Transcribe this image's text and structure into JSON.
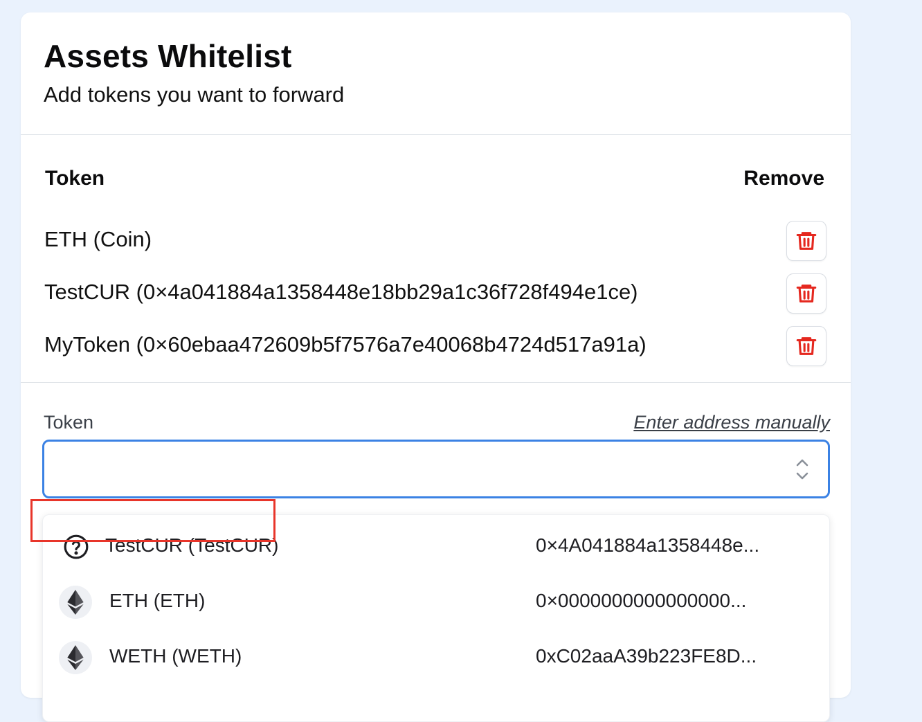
{
  "header": {
    "title": "Assets Whitelist",
    "subtitle": "Add tokens you want to forward"
  },
  "token_table": {
    "col_token": "Token",
    "col_remove": "Remove",
    "rows": [
      {
        "label": "ETH (Coin)"
      },
      {
        "label": "TestCUR (0×4a041884a1358448e18bb29a1c36f728f494e1ce)"
      },
      {
        "label": "MyToken (0×60ebaa472609b5f7576a7e40068b4724d517a91a)"
      }
    ]
  },
  "form": {
    "field_label": "Token",
    "manual_link": "Enter address manually",
    "select_value": ""
  },
  "dropdown": {
    "options": [
      {
        "name": "TestCUR (TestCUR)",
        "address": "0×4A041884a1358448e...",
        "icon": "question-circle-icon"
      },
      {
        "name": "ETH (ETH)",
        "address": "0×0000000000000000...",
        "icon": "ethereum-icon"
      },
      {
        "name": "WETH (WETH)",
        "address": "0xC02aaA39b223FE8D...",
        "icon": "ethereum-icon"
      }
    ]
  },
  "colors": {
    "page_bg": "#eaf2fd",
    "accent": "#3b82e4",
    "danger": "#e5281f",
    "highlight": "#e8352a"
  }
}
